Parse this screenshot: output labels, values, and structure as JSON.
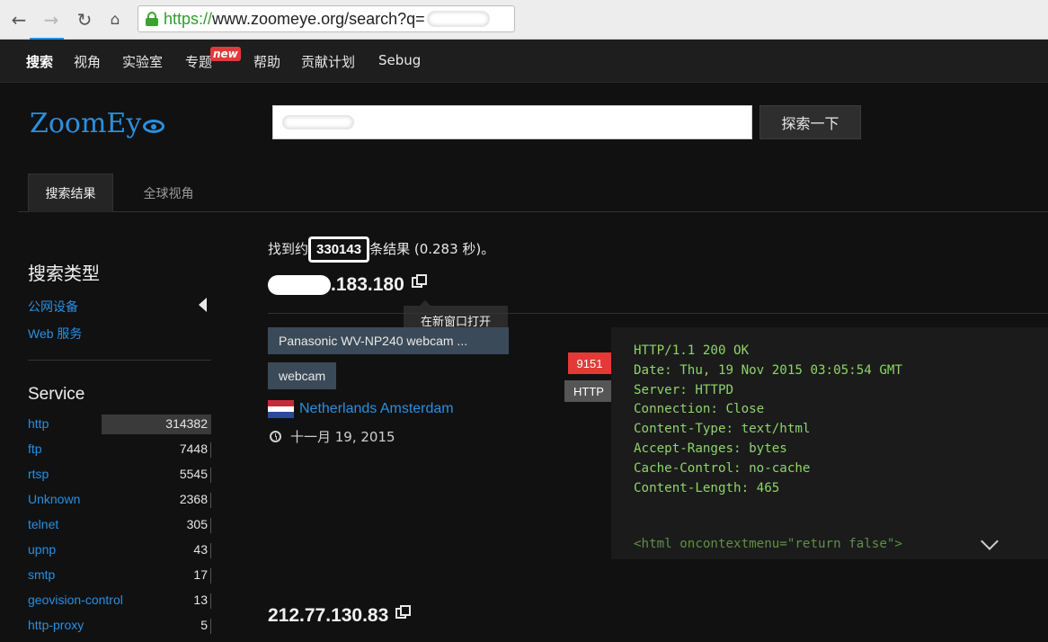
{
  "browser": {
    "url_scheme": "https://",
    "url_rest": "www.zoomeye.org/search?q="
  },
  "topnav": {
    "items": [
      "搜索",
      "视角",
      "实验室",
      "专题",
      "帮助",
      "贡献计划",
      "Sebug"
    ],
    "new_badge": "new"
  },
  "header": {
    "logo": "ZoomEy",
    "search_button": "探索一下"
  },
  "tabs": [
    "搜索结果",
    "全球视角"
  ],
  "sidebar": {
    "type_heading": "搜索类型",
    "type_links": [
      "公网设备",
      "Web 服务"
    ],
    "service_heading": "Service",
    "services": [
      {
        "name": "http",
        "count": "314382"
      },
      {
        "name": "ftp",
        "count": "7448"
      },
      {
        "name": "rtsp",
        "count": "5545"
      },
      {
        "name": "Unknown",
        "count": "2368"
      },
      {
        "name": "telnet",
        "count": "305"
      },
      {
        "name": "upnp",
        "count": "43"
      },
      {
        "name": "smtp",
        "count": "17"
      },
      {
        "name": "geovision-control",
        "count": "13"
      },
      {
        "name": "http-proxy",
        "count": "5"
      }
    ]
  },
  "results": {
    "summary_prefix": "找到约",
    "summary_count": "330143",
    "summary_suffix": "条结果 (0.283 秒)。",
    "result1": {
      "ip_suffix": ".183.180",
      "tooltip": "在新窗口打开",
      "title_tag": "Panasonic WV-NP240 webcam ...",
      "device_tag": "webcam",
      "location": "Netherlands Amsterdam",
      "date": "十一月 19, 2015",
      "port": "9151",
      "protocol": "HTTP",
      "banner_lines": [
        "HTTP/1.1 200 OK",
        "Date: Thu, 19 Nov 2015 03:05:54 GMT",
        "Server: HTTPD",
        "Connection: Close",
        "Content-Type: text/html",
        "Accept-Ranges: bytes",
        "Cache-Control: no-cache",
        "Content-Length: 465"
      ],
      "banner_tail": "<html oncontextmenu=\"return false\">"
    },
    "result2": {
      "ip": "212.77.130.83"
    }
  },
  "colors": {
    "link": "#2b8fe0",
    "banner_text": "#8fd36b",
    "port_badge": "#e33a37",
    "tag_bg": "#3b4a58"
  }
}
